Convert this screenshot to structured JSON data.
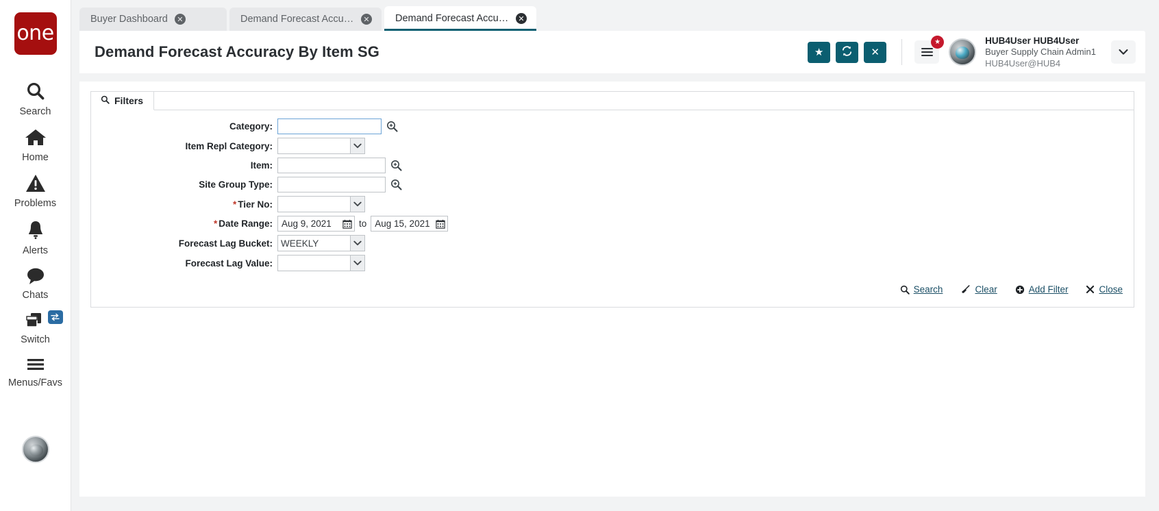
{
  "app": {
    "logo_text": "one",
    "brand_color": "#a50f0f",
    "accent_color": "#0b5e70"
  },
  "sidebar": {
    "items": [
      {
        "label": "Search",
        "icon": "search-icon"
      },
      {
        "label": "Home",
        "icon": "home-icon"
      },
      {
        "label": "Problems",
        "icon": "warning-triangle-icon"
      },
      {
        "label": "Alerts",
        "icon": "bell-icon"
      },
      {
        "label": "Chats",
        "icon": "chat-bubble-icon"
      },
      {
        "label": "Switch",
        "icon": "windows-switch-icon",
        "badge_icon": "swap-arrows-icon"
      },
      {
        "label": "Menus/Favs",
        "icon": "hamburger-icon"
      }
    ],
    "avatar_name": "user-avatar"
  },
  "tabs": [
    {
      "label": "Buyer Dashboard",
      "active": false,
      "close_icon": "close-circle-icon"
    },
    {
      "label": "Demand Forecast Accuracy Sum...",
      "active": false,
      "close_icon": "close-circle-icon"
    },
    {
      "label": "Demand Forecast Accuracy By It...",
      "active": true,
      "close_icon": "close-circle-icon"
    }
  ],
  "header": {
    "title": "Demand Forecast Accuracy By Item SG",
    "buttons": [
      {
        "name": "favorite-button",
        "icon": "star-icon",
        "glyph": "★"
      },
      {
        "name": "refresh-button",
        "icon": "refresh-icon",
        "glyph": "↻"
      },
      {
        "name": "close-button",
        "icon": "x-icon",
        "glyph": "✕"
      }
    ],
    "menu_badge_icon": "star-badge-icon",
    "menu_badge_glyph": "★",
    "user": {
      "name": "HUB4User HUB4User",
      "role": "Buyer Supply Chain Admin1",
      "email": "HUB4User@HUB4"
    },
    "caret_glyph": "⌄"
  },
  "filters": {
    "tab_label": "Filters",
    "tab_icon": "search-icon",
    "fields": [
      {
        "label": "Category:",
        "required": false,
        "type": "text",
        "value": "",
        "placeholder": "",
        "focused": true,
        "lookup": true
      },
      {
        "label": "Item Repl Category:",
        "required": false,
        "type": "select",
        "value": "",
        "options": [
          ""
        ]
      },
      {
        "label": "Item:",
        "required": false,
        "type": "text",
        "value": "",
        "placeholder": "",
        "focused": false,
        "lookup": true
      },
      {
        "label": "Site Group Type:",
        "required": false,
        "type": "text",
        "value": "",
        "placeholder": "",
        "focused": false,
        "lookup": true
      },
      {
        "label": "Tier No:",
        "required": true,
        "type": "select",
        "value": "",
        "options": [
          ""
        ]
      },
      {
        "label": "Date Range:",
        "required": true,
        "type": "daterange",
        "from_value": "Aug 9, 2021",
        "to_value": "Aug 15, 2021",
        "separator": "to"
      },
      {
        "label": "Forecast Lag Bucket:",
        "required": false,
        "type": "select",
        "value": "WEEKLY",
        "options": [
          "WEEKLY"
        ]
      },
      {
        "label": "Forecast Lag Value:",
        "required": false,
        "type": "select",
        "value": "",
        "options": [
          ""
        ]
      }
    ],
    "actions": [
      {
        "label": "Search",
        "icon": "search-icon"
      },
      {
        "label": "Clear",
        "icon": "broom-icon"
      },
      {
        "label": "Add Filter",
        "icon": "plus-circle-icon"
      },
      {
        "label": "Close",
        "icon": "x-icon"
      }
    ]
  }
}
